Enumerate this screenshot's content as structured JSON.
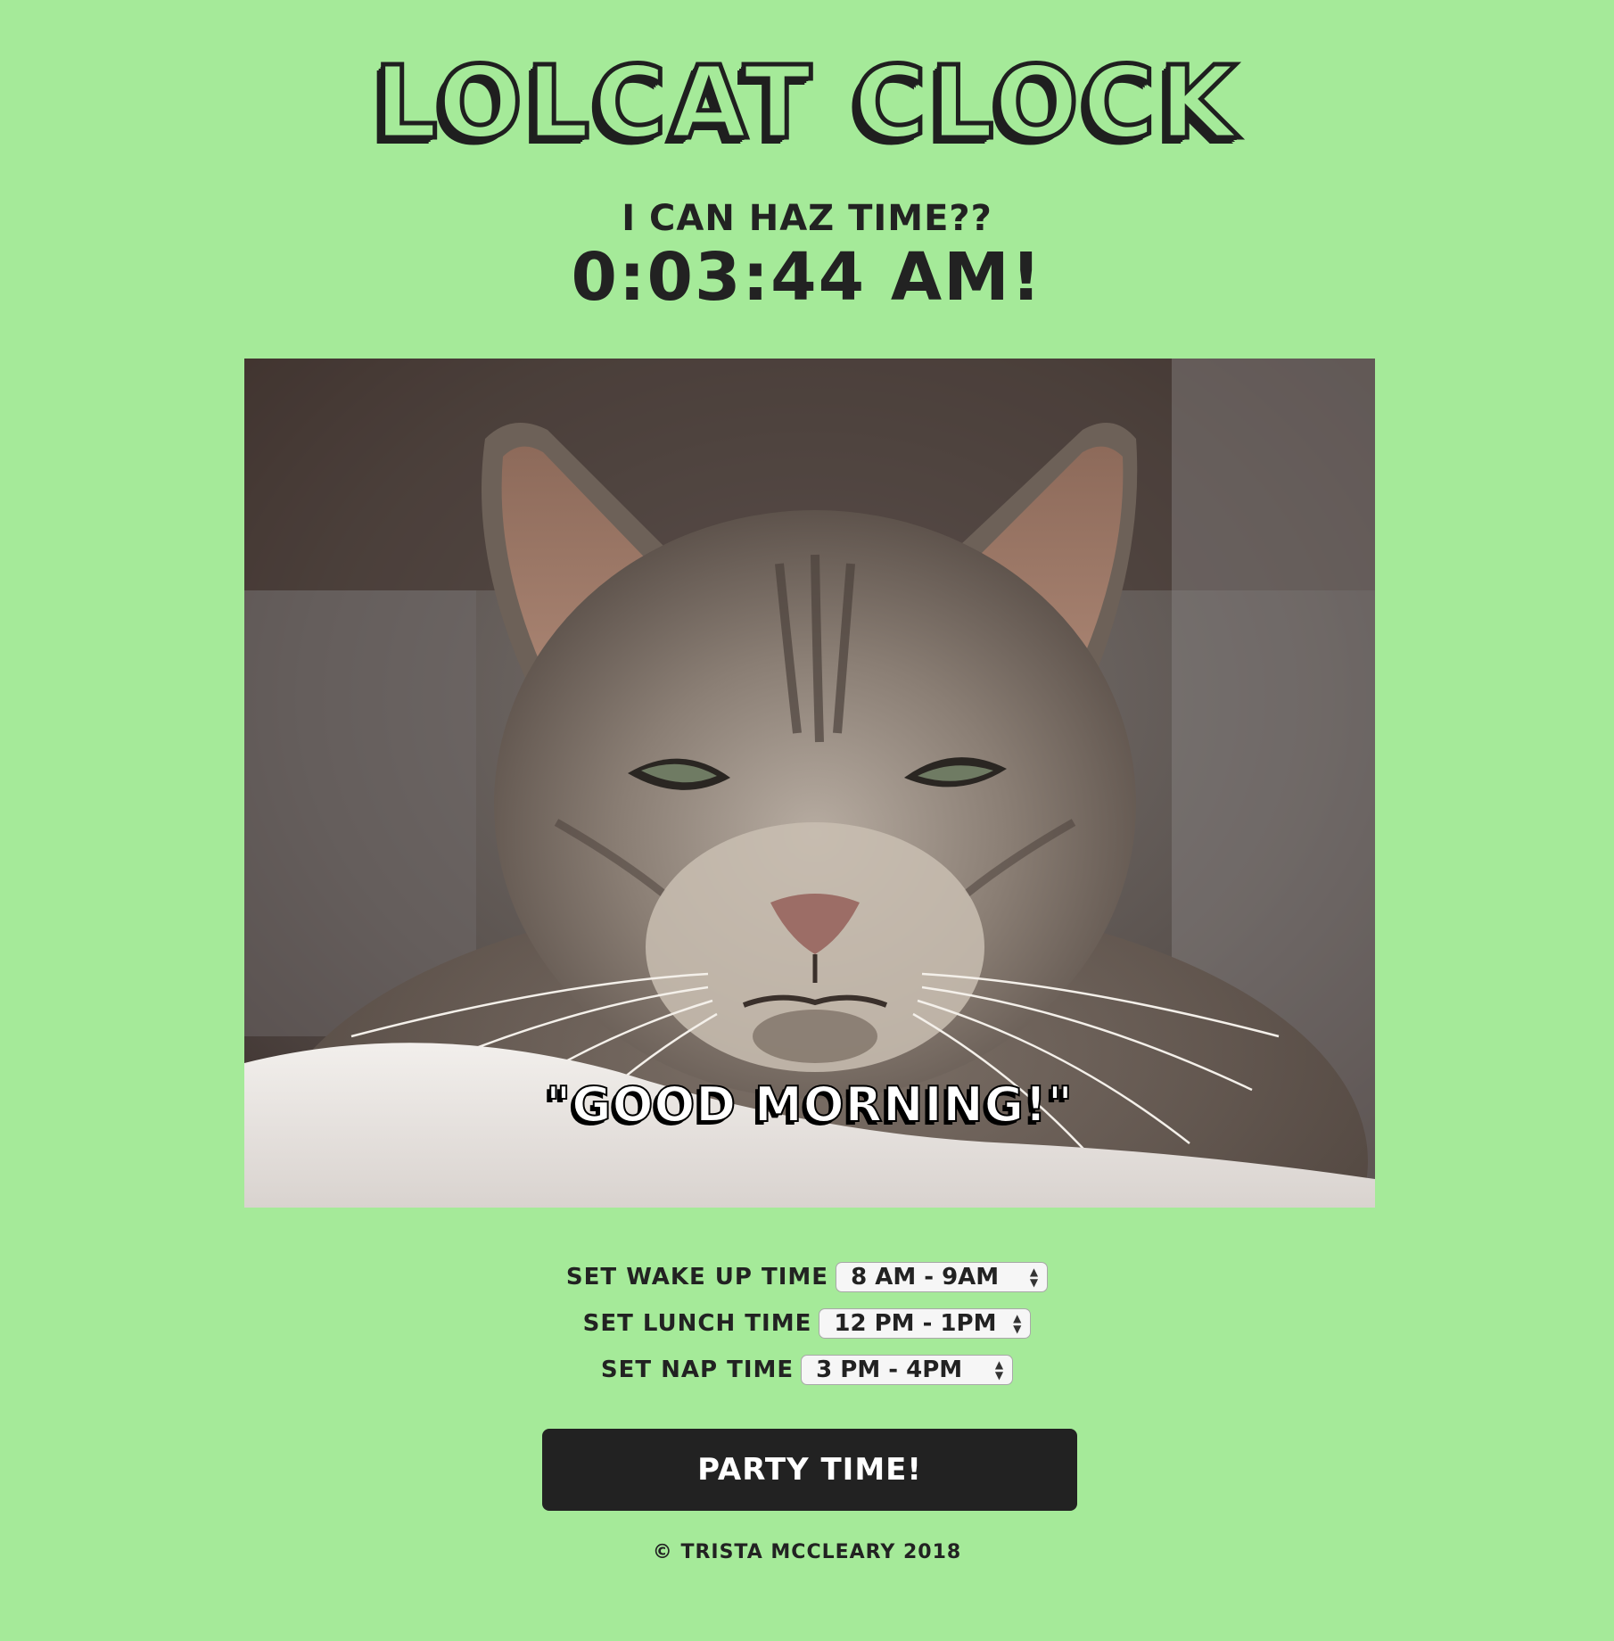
{
  "header": {
    "title": "LOLCAT CLOCK",
    "subtitle": "I CAN HAZ TIME??",
    "clock": "0:03:44 AM!"
  },
  "photo": {
    "caption": "\"GOOD MORNING!\""
  },
  "controls": {
    "wake": {
      "label": "SET WAKE UP TIME",
      "value": "8 AM - 9AM"
    },
    "lunch": {
      "label": "SET LUNCH TIME",
      "value": "12 PM - 1PM"
    },
    "nap": {
      "label": "SET NAP TIME",
      "value": "3 PM - 4PM"
    }
  },
  "party_button": "PARTY TIME!",
  "footer": "© TRISTA MCCLEARY 2018",
  "colors": {
    "background": "#a5ea99",
    "text": "#222222",
    "button": "#222222"
  }
}
